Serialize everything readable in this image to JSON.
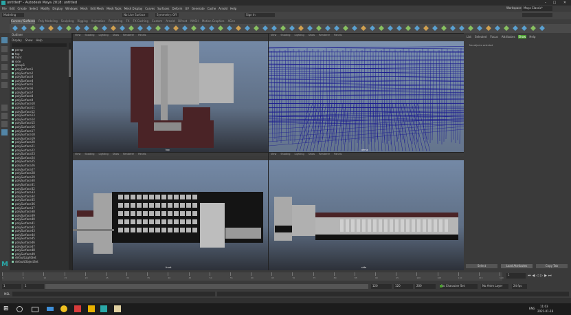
{
  "window": {
    "title": "untitled* - Autodesk Maya 2018: untitled",
    "controls": [
      "–",
      "□",
      "✕"
    ]
  },
  "menubar": {
    "items": [
      "File",
      "Edit",
      "Create",
      "Select",
      "Modify",
      "Display",
      "Windows",
      "Mesh",
      "Edit Mesh",
      "Mesh Tools",
      "Mesh Display",
      "Curves",
      "Surfaces",
      "Deform",
      "UV",
      "Generate",
      "Cache",
      "Arnold",
      "Help"
    ],
    "workspace_label": "Workspace :",
    "workspace_value": "Maya Classic*"
  },
  "statusline": {
    "mode": "Modeling",
    "no_live": "No Live Surface",
    "symmetry": "Symmetry: Off",
    "render_field": "Sign In"
  },
  "shelf": {
    "tabs": [
      "Curves / Surfaces",
      "Poly Modeling",
      "Sculpting",
      "Rigging",
      "Animation",
      "Rendering",
      "FX",
      "FX Caching",
      "Custom",
      "Arnold",
      "Bifrost",
      "MASH",
      "Motion Graphics",
      "XGen"
    ],
    "active_index": 0
  },
  "outliner": {
    "title": "Outliner",
    "menus": [
      "Display",
      "Show",
      "Help"
    ],
    "rows": [
      "persp",
      "top",
      "front",
      "side",
      "group1",
      "polySurface1",
      "polySurface2",
      "polySurface3",
      "polySurface4",
      "polySurface5",
      "polySurface6",
      "polySurface7",
      "polySurface8",
      "polySurface9",
      "polySurface10",
      "polySurface11",
      "polySurface12",
      "polySurface13",
      "polySurface14",
      "polySurface15",
      "polySurface16",
      "polySurface17",
      "polySurface18",
      "polySurface19",
      "polySurface20",
      "polySurface21",
      "polySurface22",
      "polySurface23",
      "polySurface24",
      "polySurface25",
      "polySurface26",
      "polySurface27",
      "polySurface28",
      "polySurface29",
      "polySurface30",
      "polySurface31",
      "polySurface32",
      "polySurface33",
      "polySurface34",
      "polySurface35",
      "polySurface36",
      "polySurface37",
      "polySurface38",
      "polySurface39",
      "polySurface40",
      "polySurface41",
      "polySurface42",
      "polySurface43",
      "polySurface44",
      "polySurface45",
      "polySurface46",
      "polySurface47",
      "polySurface48",
      "polySurface49",
      "defaultLightSet",
      "defaultObjectSet"
    ]
  },
  "viewports": {
    "menus": [
      "View",
      "Shading",
      "Lighting",
      "Show",
      "Renderer",
      "Panels"
    ],
    "top": {
      "label": "top"
    },
    "persp": {
      "label": "persp"
    },
    "front": {
      "label": "front"
    },
    "side": {
      "label": "side"
    }
  },
  "attribute_editor": {
    "tabs": [
      "List",
      "Selected",
      "Focus",
      "Attributes",
      "Show",
      "Help"
    ],
    "active_tab": "Show",
    "info": "No objects selected",
    "buttons": [
      "Select",
      "Load Attributes",
      "Copy Tab"
    ]
  },
  "timeline": {
    "ticks": [
      "1",
      "5",
      "10",
      "15",
      "20",
      "25",
      "30",
      "35",
      "40",
      "45",
      "50",
      "55",
      "60",
      "65",
      "70",
      "75",
      "80",
      "85",
      "90",
      "95",
      "100",
      "105",
      "110",
      "115",
      "120"
    ],
    "current_frame": "1"
  },
  "range": {
    "start": "1",
    "range_start": "1",
    "range_end": "120",
    "end_a": "120",
    "end_b": "200",
    "fps": "24 fps",
    "char_set": "No Character Set",
    "anim_layer": "No Anim Layer"
  },
  "commandline": {
    "lang": "MEL"
  },
  "taskbar": {
    "time": "11:03",
    "date": "2021-01-16",
    "lang": "ENG"
  },
  "colors": {
    "accent": "#49a02c",
    "maya_teal": "#2aa7a7",
    "wire": "#1a1a8f",
    "brick": "#4a2326"
  }
}
